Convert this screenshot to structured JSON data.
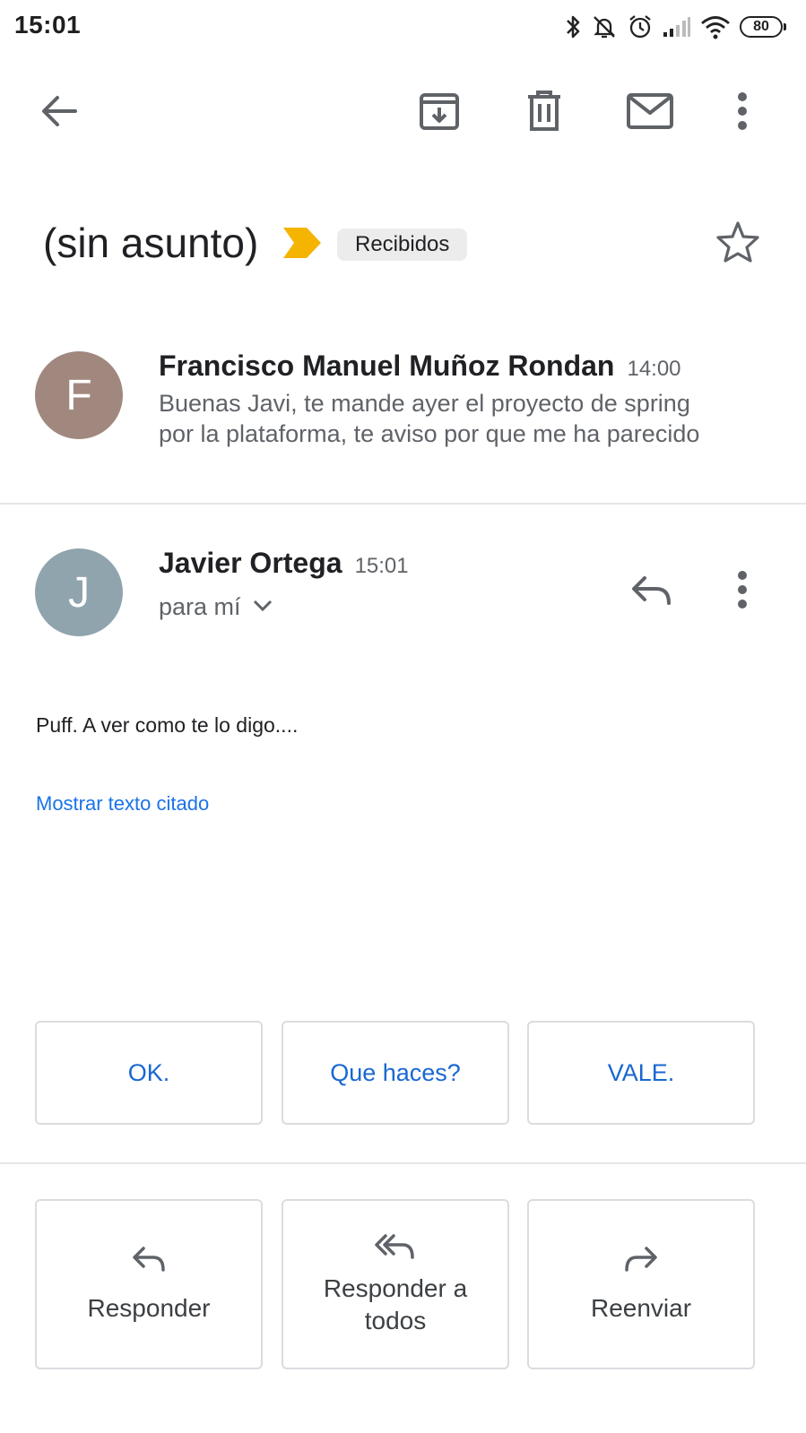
{
  "status_bar": {
    "time": "15:01",
    "icons": [
      "bluetooth-icon",
      "notifications-off-icon",
      "alarm-icon",
      "signal-icon",
      "wifi-icon"
    ],
    "battery": "80"
  },
  "toolbar": {
    "icons": [
      "back-arrow-icon",
      "archive-icon",
      "delete-icon",
      "mail-unread-icon",
      "more-vert-icon"
    ]
  },
  "subject": {
    "title": "(sin asunto)",
    "importance_color": "#f4b400",
    "label": "Recibidos"
  },
  "messages": [
    {
      "avatar_letter": "F",
      "avatar_color": "#a1887f",
      "sender": "Francisco Manuel Muñoz Rondan",
      "time": "14:00",
      "snippet_line1": "Buenas Javi, te mande ayer el proyecto de spring",
      "snippet_line2": "por la plataforma, te aviso por que me ha parecido"
    },
    {
      "avatar_letter": "J",
      "avatar_color": "#90a4ae",
      "sender": "Javier Ortega",
      "time": "15:01",
      "recipient": "para mí",
      "body": "Puff. A ver como te lo digo....",
      "show_quoted": "Mostrar texto citado"
    }
  ],
  "smart_replies": [
    "OK.",
    "Que haces?",
    "VALE."
  ],
  "actions": [
    {
      "label": "Responder",
      "icon": "reply-icon"
    },
    {
      "label": "Responder a todos",
      "icon": "reply-all-icon"
    },
    {
      "label": "Reenviar",
      "icon": "forward-icon"
    }
  ],
  "colors": {
    "link": "#1a73e8",
    "smart_reply_text": "#1967d2"
  }
}
